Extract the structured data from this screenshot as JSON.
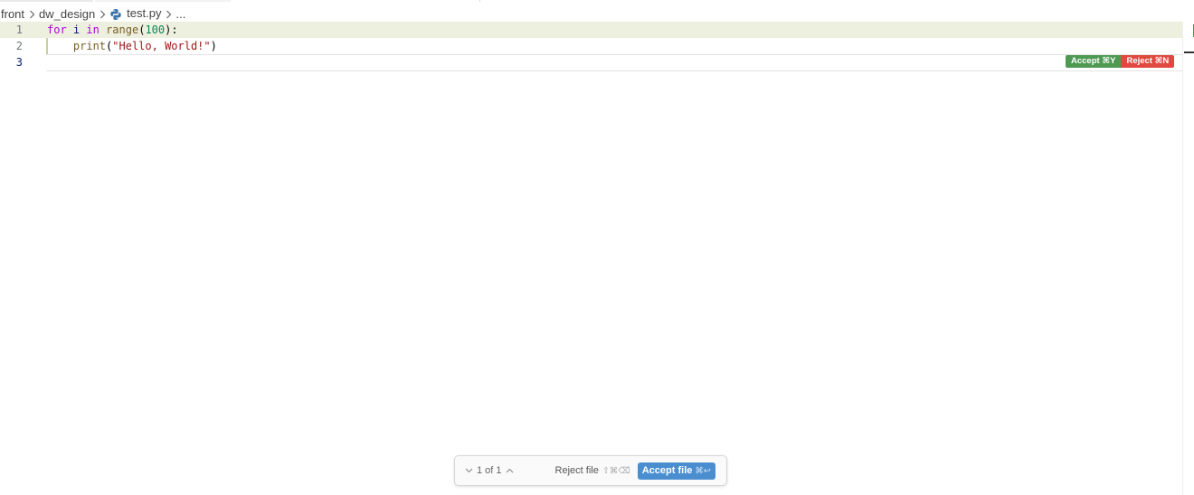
{
  "breadcrumb": {
    "items": [
      "front",
      "dw_design",
      "test.py",
      "..."
    ],
    "file_icon": "python-icon"
  },
  "editor": {
    "lines": [
      {
        "number": "1",
        "tokens": [
          {
            "t": "for",
            "c": "kw"
          },
          {
            "t": " ",
            "c": "punc"
          },
          {
            "t": "i",
            "c": "var"
          },
          {
            "t": " ",
            "c": "punc"
          },
          {
            "t": "in",
            "c": "kw"
          },
          {
            "t": " ",
            "c": "punc"
          },
          {
            "t": "range",
            "c": "fn"
          },
          {
            "t": "(",
            "c": "punc"
          },
          {
            "t": "100",
            "c": "num"
          },
          {
            "t": "):",
            "c": "punc"
          }
        ]
      },
      {
        "number": "2",
        "tokens": [
          {
            "t": "    ",
            "c": "punc"
          },
          {
            "t": "print",
            "c": "fn"
          },
          {
            "t": "(",
            "c": "punc"
          },
          {
            "t": "\"Hello, World!\"",
            "c": "str"
          },
          {
            "t": ")",
            "c": "punc"
          }
        ]
      },
      {
        "number": "3",
        "tokens": []
      }
    ],
    "accept_label": "Accept ⌘Y",
    "reject_label": "Reject ⌘N",
    "added_line_color": "#eef0df"
  },
  "review_bar": {
    "counter": "1 of 1",
    "reject_file_label": "Reject file",
    "reject_file_shortcut": "⇧⌘⌫",
    "accept_file_label": "Accept file",
    "accept_file_shortcut": "⌘↩",
    "accept_color": "#4a8ed0"
  }
}
